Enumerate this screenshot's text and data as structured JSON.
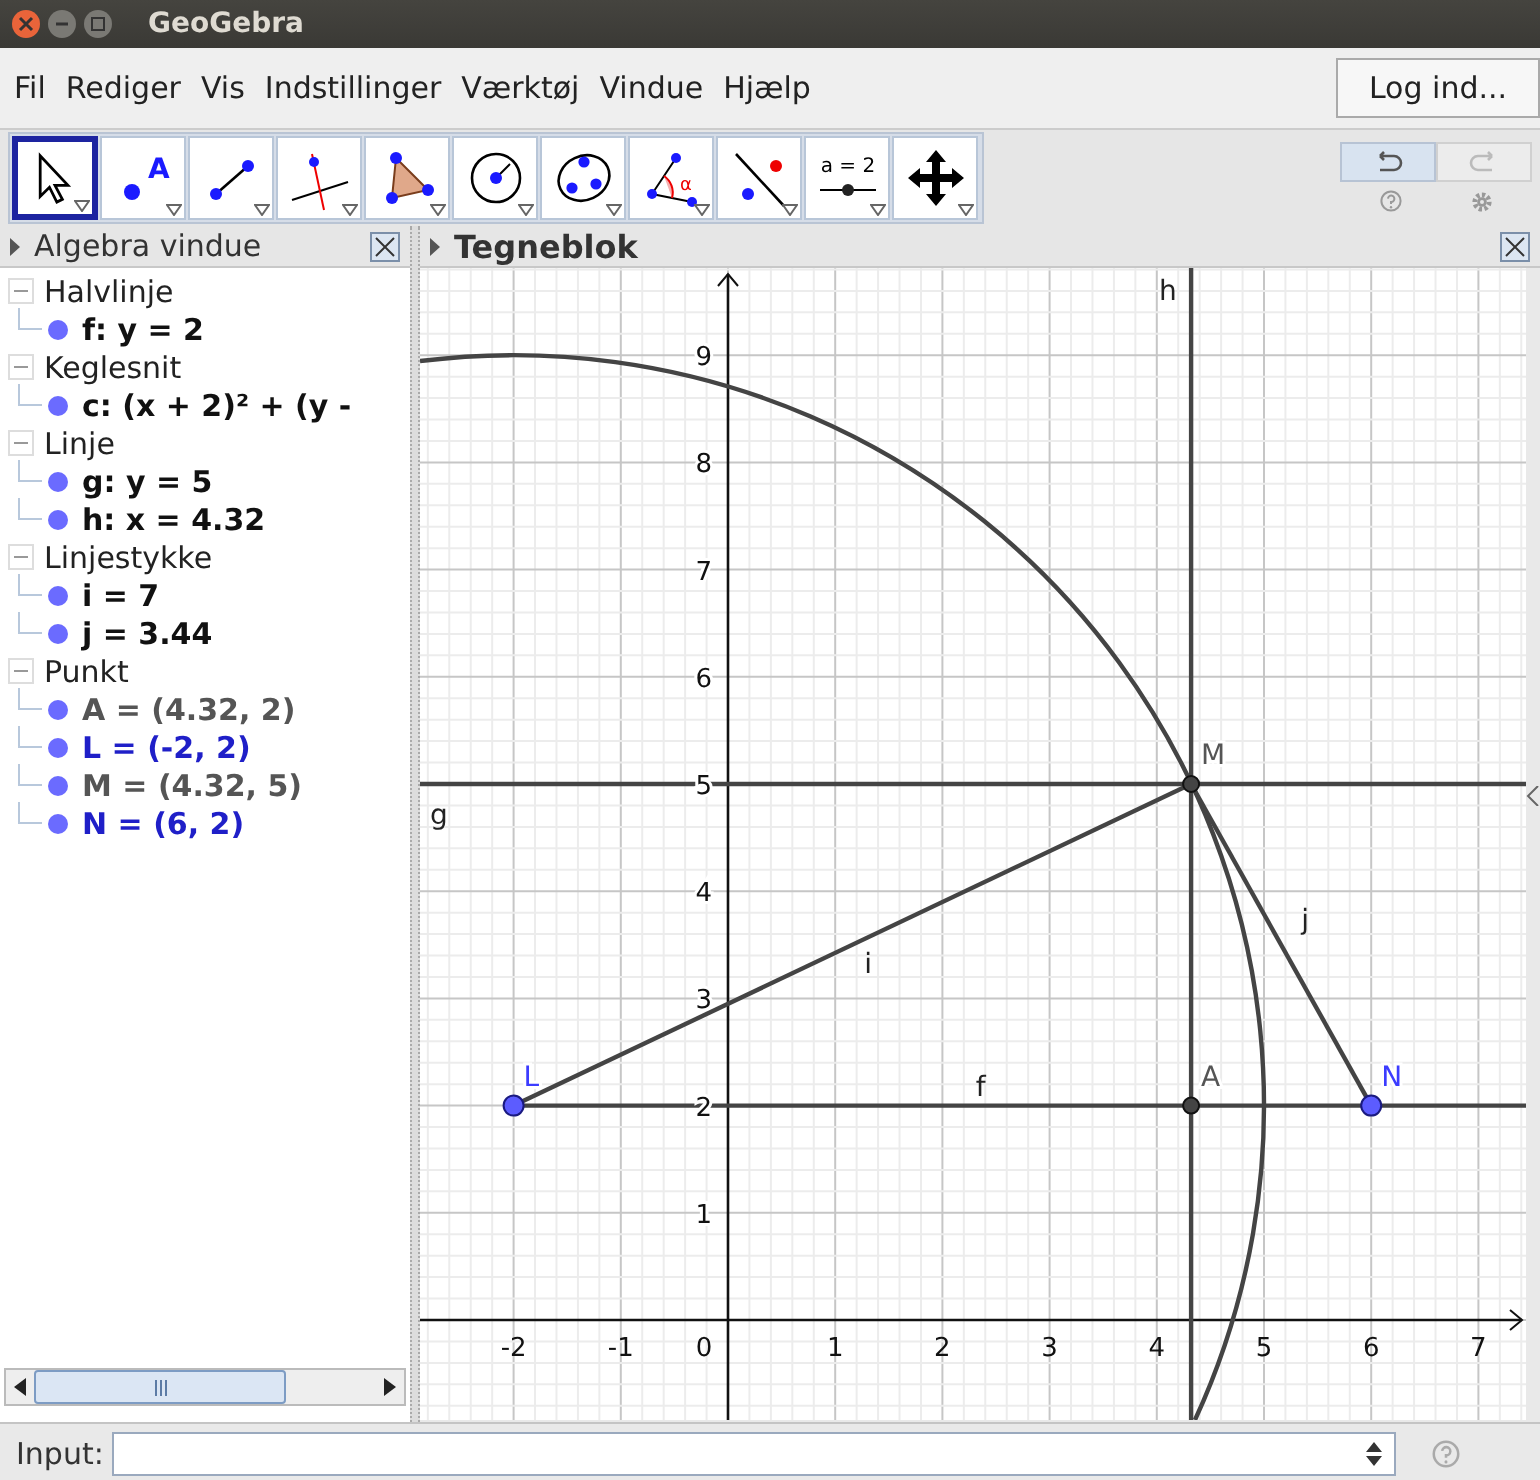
{
  "window": {
    "title": "GeoGebra"
  },
  "menu": [
    "Fil",
    "Rediger",
    "Vis",
    "Indstillinger",
    "Værktøj",
    "Vindue",
    "Hjælp"
  ],
  "login_button": "Log ind...",
  "toolbar": {
    "tools": [
      {
        "kind": "move",
        "selected": true
      },
      {
        "kind": "point",
        "label": "A",
        "selected": false
      },
      {
        "kind": "segment",
        "selected": false
      },
      {
        "kind": "perpendicular",
        "selected": false
      },
      {
        "kind": "polygon",
        "selected": false
      },
      {
        "kind": "circle",
        "selected": false
      },
      {
        "kind": "conic",
        "selected": false
      },
      {
        "kind": "angle",
        "label": "α",
        "selected": false
      },
      {
        "kind": "reflect",
        "selected": false
      },
      {
        "kind": "slider",
        "label": "a = 2",
        "selected": false
      },
      {
        "kind": "move-view",
        "selected": false
      }
    ],
    "undo": {
      "disabled": false
    },
    "redo": {
      "disabled": true
    }
  },
  "algebra": {
    "title": "Algebra vindue",
    "groups": [
      {
        "name": "Halvlinje",
        "expanded": true,
        "children": [
          {
            "text": "f: y = 2",
            "kind": "object"
          }
        ]
      },
      {
        "name": "Keglesnit",
        "expanded": true,
        "children": [
          {
            "text": "c: (x + 2)² + (y -",
            "kind": "object"
          }
        ]
      },
      {
        "name": "Linje",
        "expanded": true,
        "children": [
          {
            "text": "g: y = 5",
            "kind": "object"
          },
          {
            "text": "h: x = 4.32",
            "kind": "object"
          }
        ]
      },
      {
        "name": "Linjestykke",
        "expanded": true,
        "children": [
          {
            "text": "i = 7",
            "kind": "object"
          },
          {
            "text": "j = 3.44",
            "kind": "object"
          }
        ]
      },
      {
        "name": "Punkt",
        "expanded": true,
        "children": [
          {
            "text": "A = (4.32, 2)",
            "kind": "dependent"
          },
          {
            "text": "L = (-2, 2)",
            "kind": "free"
          },
          {
            "text": "M = (4.32, 5)",
            "kind": "dependent"
          },
          {
            "text": "N = (6, 2)",
            "kind": "free"
          }
        ]
      }
    ]
  },
  "graphics": {
    "title": "Tegneblok",
    "yticks": [
      "9",
      "8",
      "7",
      "6",
      "5",
      "4",
      "3",
      "2",
      "1"
    ],
    "xticks": [
      "-2",
      "-1",
      "0",
      "1",
      "2",
      "3",
      "4",
      "5",
      "6",
      "7"
    ],
    "objects": [
      {
        "kind": "circle"
      },
      {
        "kind": "hline",
        "label": "g"
      },
      {
        "kind": "vline",
        "label": "h"
      },
      {
        "kind": "ray",
        "label": "f"
      },
      {
        "kind": "segment",
        "label": "i"
      },
      {
        "kind": "segment",
        "label": "j"
      }
    ],
    "points": [
      {
        "label": "M",
        "kind": "dependent"
      },
      {
        "label": "L",
        "kind": "free"
      },
      {
        "label": "A",
        "kind": "dependent"
      },
      {
        "label": "N",
        "kind": "free"
      }
    ]
  },
  "input_bar": {
    "label": "Input:"
  }
}
